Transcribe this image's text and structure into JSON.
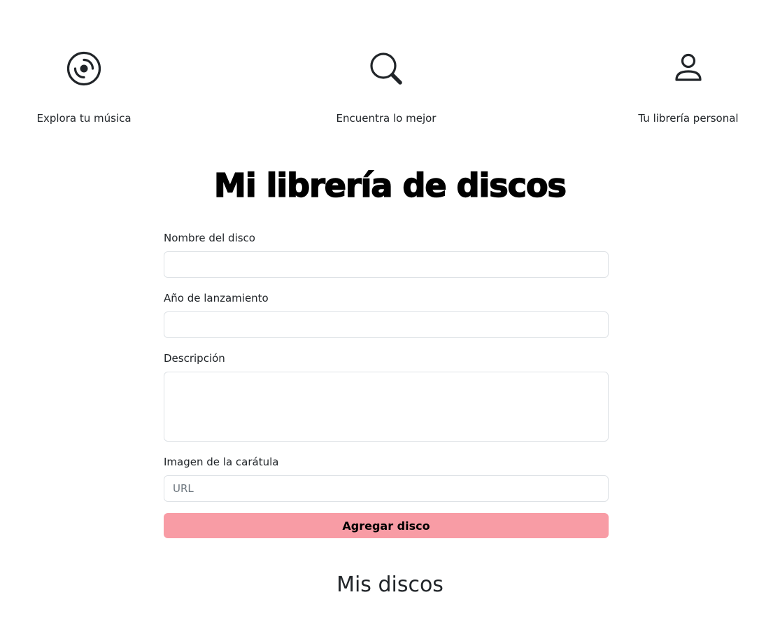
{
  "features": [
    {
      "icon": "vinyl-disc-icon",
      "caption": "Explora tu música"
    },
    {
      "icon": "search-icon",
      "caption": "Encuentra lo mejor"
    },
    {
      "icon": "person-icon",
      "caption": "Tu librería personal"
    }
  ],
  "page_title": "Mi librería de discos",
  "form": {
    "name_label": "Nombre del disco",
    "name_value": "",
    "year_label": "Año de lanzamiento",
    "year_value": "",
    "description_label": "Descripción",
    "description_value": "",
    "cover_label": "Imagen de la carátula",
    "cover_placeholder": "URL",
    "submit_label": "Agregar disco"
  },
  "colors": {
    "button_bg": "#f89ca5",
    "border": "#dee2e6",
    "text": "#212529"
  },
  "section_title": "Mis discos"
}
